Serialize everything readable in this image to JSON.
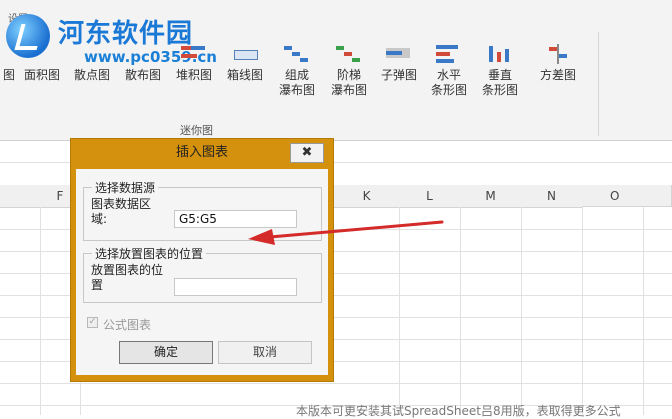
{
  "ribbon": {
    "tab_label": "设置",
    "watermark_title": "河东软件园",
    "watermark_url": "www.pc0359.cn",
    "items": [
      {
        "label": "图",
        "label2": ""
      },
      {
        "label": "面积图",
        "label2": ""
      },
      {
        "label": "散点图",
        "label2": ""
      },
      {
        "label": "散布图",
        "label2": ""
      },
      {
        "label": "堆积图",
        "label2": ""
      },
      {
        "label": "箱线图",
        "label2": ""
      },
      {
        "label": "组成",
        "label2": "瀑布图"
      },
      {
        "label": "阶梯",
        "label2": "瀑布图"
      },
      {
        "label": "子弹图",
        "label2": ""
      },
      {
        "label": "水平",
        "label2": "条形图"
      },
      {
        "label": "垂直",
        "label2": "条形图"
      },
      {
        "label": "方差图",
        "label2": ""
      }
    ],
    "group_label": "迷你图"
  },
  "grid": {
    "columns": [
      "F",
      "K",
      "L",
      "M",
      "N",
      "O"
    ]
  },
  "dialog": {
    "title": "插入图表",
    "close_glyph": "✖",
    "source_section": {
      "legend": "选择数据源",
      "field_label_line1": "图表数据区",
      "field_label_line2": "域:",
      "field_value": "G5:G5"
    },
    "position_section": {
      "legend": "选择放置图表的位置",
      "field_label_line1": "放置图表的位",
      "field_label_line2": "置",
      "field_value": ""
    },
    "formula_chart_label": "公式图表",
    "formula_chart_checked": true,
    "ok_label": "确定",
    "cancel_label": "取消"
  },
  "status_text": "本版本可更安装其试SpreadSheet吕8用版，表取得更多公式",
  "colors": {
    "dialog_frame": "#d4910d",
    "arrow": "#d42a2a",
    "watermark": "#1a78d6"
  }
}
